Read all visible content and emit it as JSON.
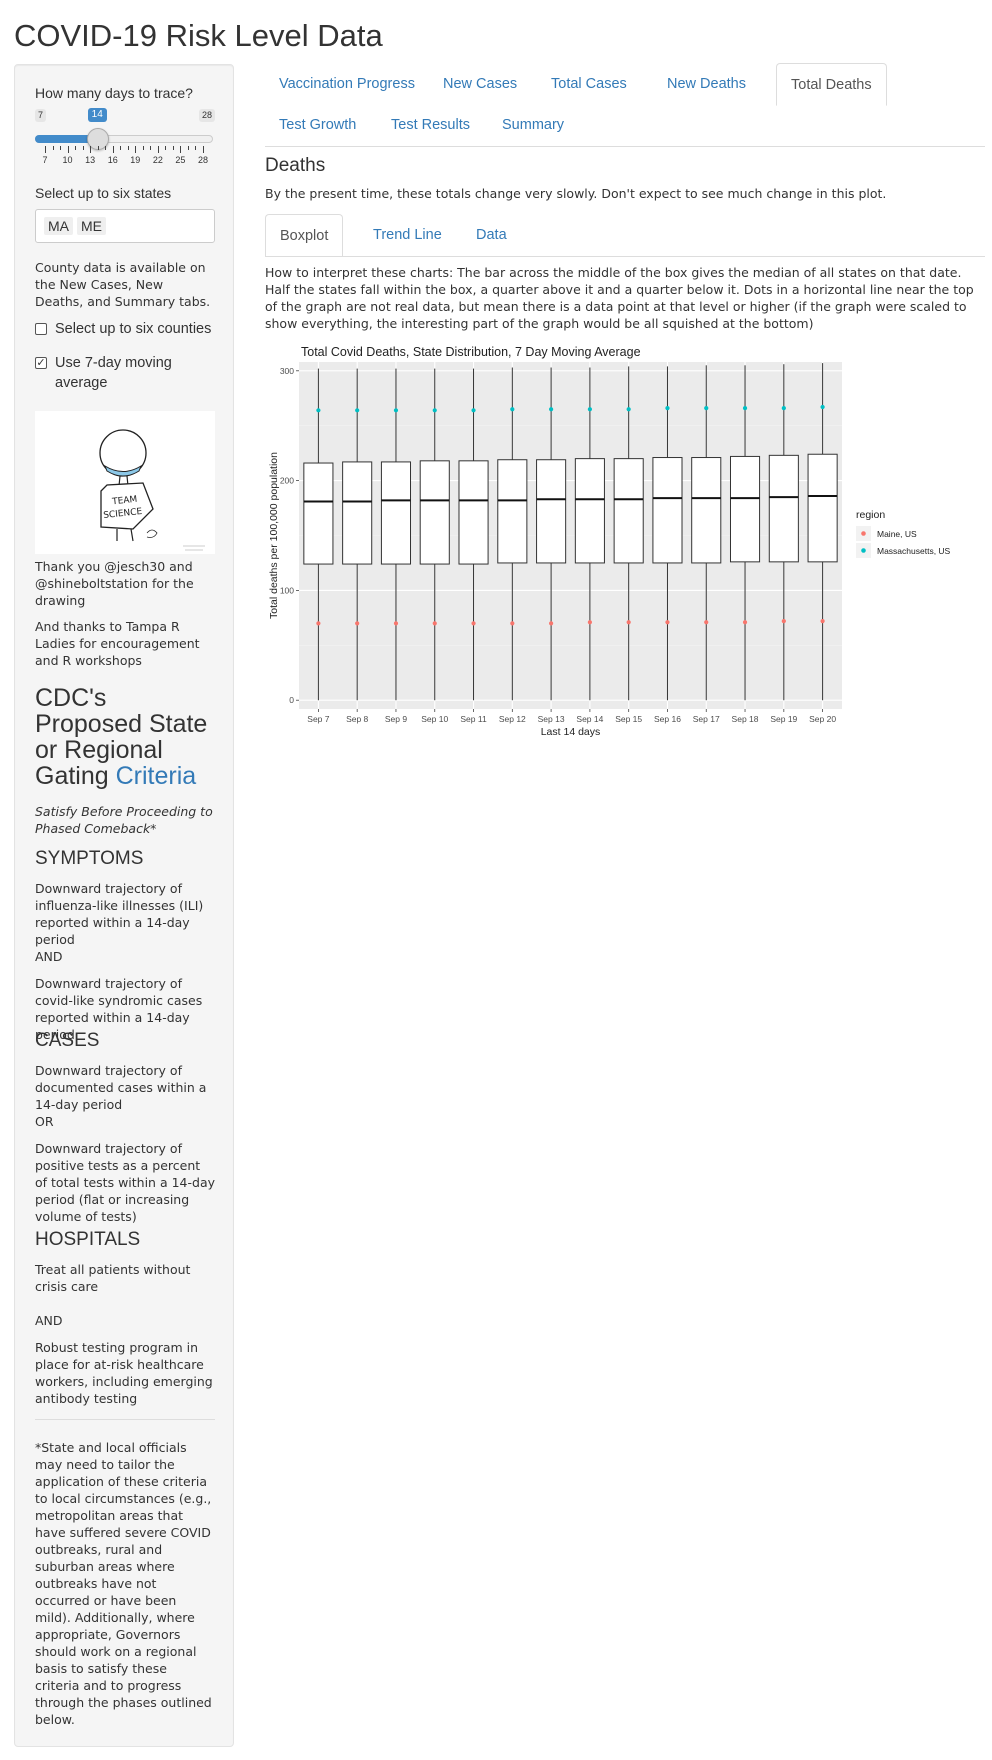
{
  "app": {
    "title": "COVID-19 Risk Level Data"
  },
  "sidebar": {
    "slider": {
      "label": "How many days to trace?",
      "min": 7,
      "max": 28,
      "value": 14,
      "ticks": [
        7,
        10,
        13,
        16,
        19,
        22,
        25,
        28
      ]
    },
    "states": {
      "label": "Select up to six states",
      "selected": [
        "MA",
        "ME"
      ]
    },
    "county_note": "County data is available on the New Cases, New Deaths, and Summary tabs.",
    "counties_checkbox": {
      "label": "Select up to six counties",
      "checked": false
    },
    "avg_checkbox": {
      "label": "Use 7-day moving average",
      "checked": true
    },
    "drawing": {
      "sign_line1": "TEAM",
      "sign_line2": "SCIENCE"
    },
    "thanks1": "Thank you @jesch30 and @shineboltstation for the drawing",
    "thanks2": "And thanks to Tampa R Ladies for encouragement and R workshops",
    "cdc": {
      "title_prefix": "CDC's Proposed State or Regional Gating ",
      "title_link": "Criteria",
      "subtitle": "Satisfy Before Proceeding to Phased Comeback*",
      "symptoms_h": "SYMPTOMS",
      "symptoms_1": "Downward trajectory of influenza-like illnesses (ILI) reported within a 14-day period",
      "and_1": "AND",
      "symptoms_2": "Downward trajectory of covid-like syndromic cases reported within a 14-day period",
      "cases_h": "CASES",
      "cases_1": "Downward trajectory of documented cases within a 14-day period",
      "or_1": "OR",
      "cases_2": "Downward trajectory of positive tests as a percent of total tests within a 14-day period (flat or increasing volume of tests)",
      "hospitals_h": "HOSPITALS",
      "hosp_1": "Treat all patients without crisis care",
      "and_2": "AND",
      "hosp_2": "Robust testing program in place for at-risk healthcare workers, including emerging antibody testing",
      "footnote": "*State and local officials may need to tailor the application of these criteria to local circumstances (e.g., metropolitan areas that have suffered severe COVID outbreaks, rural and suburban areas where outbreaks have not occurred or have been mild). Additionally, where appropriate, Governors should work on a regional basis to satisfy these criteria and to progress through the phases outlined below."
    }
  },
  "main": {
    "tabs": [
      {
        "label": "Vaccination Progress"
      },
      {
        "label": "New Cases"
      },
      {
        "label": "Total Cases"
      },
      {
        "label": "New Deaths"
      },
      {
        "label": "Total Deaths"
      },
      {
        "label": "Test Growth"
      },
      {
        "label": "Test Results"
      },
      {
        "label": "Summary"
      }
    ],
    "active_tab": "Total Deaths",
    "section_title": "Deaths",
    "section_note": "By the present time, these totals change very slowly. Don't expect to see much change in this plot.",
    "subtabs": [
      {
        "label": "Boxplot"
      },
      {
        "label": "Trend Line"
      },
      {
        "label": "Data"
      }
    ],
    "active_subtab": "Boxplot",
    "interpretation": "How to interpret these charts: The bar across the middle of the box gives the median of all states on that date. Half the states fall within the box, a quarter above it and a quarter below it. Dots in a horizontal line near the top of the graph are not real data, but mean there is a data point at that level or higher (if the graph were scaled to show everything, the interesting part of the graph would be all squished at the bottom)"
  },
  "colors": {
    "accent": "#337ab7",
    "maine": "#f8766d",
    "massachusetts": "#00bfc4",
    "panel_bg": "#ebebeb"
  },
  "chart_data": {
    "type": "boxplot",
    "title": "Total Covid Deaths, State Distribution, 7 Day Moving Average",
    "xlabel": "Last 14 days",
    "ylabel": "Total deaths per 100,000 population",
    "ylim": [
      -8,
      308
    ],
    "yticks": [
      0,
      100,
      200,
      300
    ],
    "categories": [
      "Sep 7",
      "Sep 8",
      "Sep 9",
      "Sep 10",
      "Sep 11",
      "Sep 12",
      "Sep 13",
      "Sep 14",
      "Sep 15",
      "Sep 16",
      "Sep 17",
      "Sep 18",
      "Sep 19",
      "Sep 20"
    ],
    "boxes": [
      {
        "whisker_low": 0,
        "q1": 124,
        "median": 181,
        "q3": 216,
        "whisker_high": 302
      },
      {
        "whisker_low": 0,
        "q1": 124,
        "median": 181,
        "q3": 217,
        "whisker_high": 302
      },
      {
        "whisker_low": 0,
        "q1": 124,
        "median": 182,
        "q3": 217,
        "whisker_high": 302
      },
      {
        "whisker_low": 0,
        "q1": 124,
        "median": 182,
        "q3": 218,
        "whisker_high": 302
      },
      {
        "whisker_low": 0,
        "q1": 124,
        "median": 182,
        "q3": 218,
        "whisker_high": 302
      },
      {
        "whisker_low": 0,
        "q1": 125,
        "median": 182,
        "q3": 219,
        "whisker_high": 303
      },
      {
        "whisker_low": 0,
        "q1": 125,
        "median": 183,
        "q3": 219,
        "whisker_high": 303
      },
      {
        "whisker_low": 0,
        "q1": 125,
        "median": 183,
        "q3": 220,
        "whisker_high": 303
      },
      {
        "whisker_low": 0,
        "q1": 125,
        "median": 183,
        "q3": 220,
        "whisker_high": 304
      },
      {
        "whisker_low": 0,
        "q1": 125,
        "median": 184,
        "q3": 221,
        "whisker_high": 304
      },
      {
        "whisker_low": 0,
        "q1": 125,
        "median": 184,
        "q3": 221,
        "whisker_high": 305
      },
      {
        "whisker_low": 0,
        "q1": 126,
        "median": 184,
        "q3": 222,
        "whisker_high": 305
      },
      {
        "whisker_low": 0,
        "q1": 126,
        "median": 185,
        "q3": 223,
        "whisker_high": 306
      },
      {
        "whisker_low": 0,
        "q1": 126,
        "median": 186,
        "q3": 224,
        "whisker_high": 307
      }
    ],
    "legend_title": "region",
    "legend_position": "right",
    "series": [
      {
        "name": "Maine, US",
        "color": "#f8766d",
        "values": [
          70,
          70,
          70,
          70,
          70,
          70,
          70,
          71,
          71,
          71,
          71,
          71,
          72,
          72
        ]
      },
      {
        "name": "Massachusetts, US",
        "color": "#00bfc4",
        "values": [
          264,
          264,
          264,
          264,
          264,
          265,
          265,
          265,
          265,
          266,
          266,
          266,
          266,
          267
        ]
      }
    ]
  }
}
